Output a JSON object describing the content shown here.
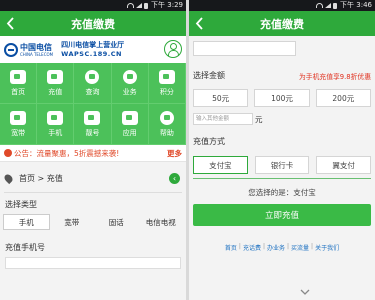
{
  "left": {
    "status_time": "下午 3:29",
    "title": "充值缴费",
    "brand": {
      "cn": "中国电信",
      "en": "CHINA TELECOM",
      "hall_cn": "四川电信掌上营业厅",
      "hall_url": "WAPSC.189.CN"
    },
    "grid": [
      {
        "label": "首页",
        "icon": "home-icon"
      },
      {
        "label": "充值",
        "icon": "recharge-icon"
      },
      {
        "label": "查询",
        "icon": "query-icon"
      },
      {
        "label": "业务",
        "icon": "service-icon"
      },
      {
        "label": "积分",
        "icon": "points-icon"
      },
      {
        "label": "宽带",
        "icon": "broadband-icon"
      },
      {
        "label": "手机",
        "icon": "phone-icon"
      },
      {
        "label": "靓号",
        "icon": "number-icon"
      },
      {
        "label": "应用",
        "icon": "apps-icon"
      },
      {
        "label": "帮助",
        "icon": "help-icon"
      }
    ],
    "notice": {
      "text": "公告：流量聚惠，5折震撼来袭!",
      "more": "更多"
    },
    "breadcrumb": "首页 > 充值",
    "type_label": "选择类型",
    "types": [
      "手机",
      "宽带",
      "固话",
      "电信电视"
    ],
    "phone_label": "充值手机号"
  },
  "right": {
    "status_time": "下午 3:46",
    "title": "充值缴费",
    "amount_label": "选择金额",
    "promo": "为手机充值享9.8折优惠",
    "amounts": [
      "50元",
      "100元",
      "200元"
    ],
    "other_placeholder": "输入其他金额",
    "other_unit": "元",
    "method_label": "充值方式",
    "methods": [
      "支付宝",
      "银行卡",
      "翼支付"
    ],
    "chosen": "您选择的是：支付宝",
    "pay_button": "立即充值",
    "footer": [
      "首页",
      "充话费",
      "办业务",
      "买流量",
      "关于我们"
    ]
  },
  "colors": {
    "brand_green": "#2ea93b",
    "grid_green": "#4cc15a",
    "telecom_blue": "#0a4ea3",
    "promo_red": "#e0301e"
  }
}
